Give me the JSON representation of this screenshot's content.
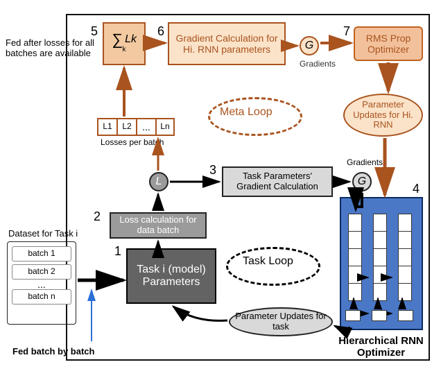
{
  "feed_after_losses": "Fed after losses for all batches are available",
  "sum_box": "∑ Lk",
  "sum_sub": "k",
  "grad_hi_rnn": "Gradient Calculation for Hi. RNN parameters",
  "rms_prop": "RMS Prop Optimizer",
  "gradients_top": "Gradients",
  "g_symbol": "G",
  "l_symbol": "L",
  "param_updates_hi": "Parameter Updates for Hi. RNN",
  "losses_per_batch": "Losses per batch",
  "loss_cells": [
    "L1",
    "L2",
    "...",
    "Ln"
  ],
  "meta_loop": "Meta Loop",
  "task_param_grad": "Task Parameters' Gradient Calculation",
  "gradients_mid": "Gradients",
  "loss_calc": "Loss calculation for data batch",
  "task_i_model": "Task i (model) Parameters",
  "task_loop": "Task Loop",
  "dataset_label": "Dataset for Task i",
  "batch1": "batch 1",
  "batch2": "batch 2",
  "batch_dots": "...",
  "batchn": "batch n",
  "fed_batch": "Fed batch by batch",
  "param_updates_task": "Parameter Updates for task",
  "hrnn_label": "Hierarchical RNN Optimizer",
  "step1": "1",
  "step2": "2",
  "step3": "3",
  "step4": "4",
  "step5": "5",
  "step6": "6",
  "step7": "7"
}
